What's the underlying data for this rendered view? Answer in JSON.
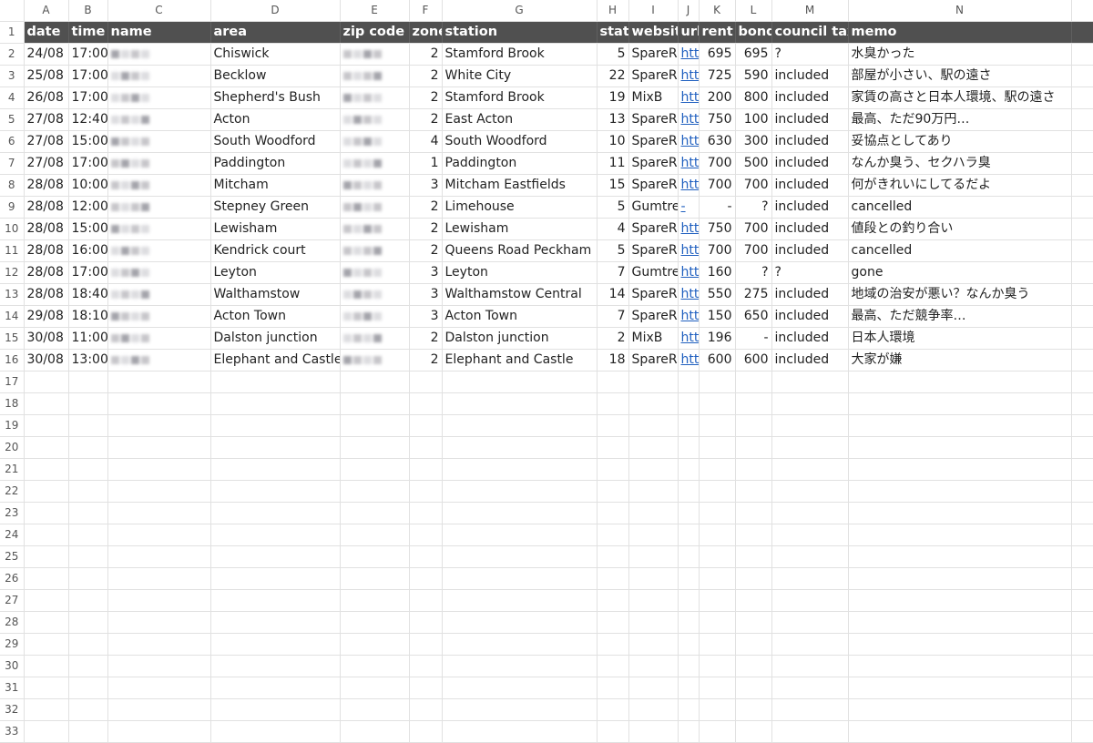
{
  "columns": [
    "A",
    "B",
    "C",
    "D",
    "E",
    "F",
    "G",
    "H",
    "I",
    "J",
    "K",
    "L",
    "M",
    "N"
  ],
  "headers": [
    "date",
    "time",
    "name",
    "area",
    "zip code",
    "zone",
    "station",
    "stati",
    "websit",
    "url",
    "rent",
    "bond",
    "council tax",
    "memo"
  ],
  "rows": [
    {
      "date": "24/08",
      "time": "17:00",
      "area": "Chiswick",
      "zone": "2",
      "station": "Stamford Brook",
      "stati": "5",
      "website": "SpareR",
      "url": "htt",
      "rent": "695",
      "bond": "695",
      "council_tax": "?",
      "memo": "水臭かった"
    },
    {
      "date": "25/08",
      "time": "17:00",
      "area": "Becklow",
      "zone": "2",
      "station": "White City",
      "stati": "22",
      "website": "SpareR",
      "url": "htt",
      "rent": "725",
      "bond": "590",
      "council_tax": "included",
      "memo": "部屋が小さい、駅の遠さ"
    },
    {
      "date": "26/08",
      "time": "17:00",
      "area": "Shepherd's Bush",
      "zone": "2",
      "station": "Stamford Brook",
      "stati": "19",
      "website": "MixB",
      "url": "htt",
      "rent": "200",
      "bond": "800",
      "council_tax": "included",
      "memo": "家賃の高さと日本人環境、駅の遠さ"
    },
    {
      "date": "27/08",
      "time": "12:40",
      "area": "Acton",
      "zone": "2",
      "station": "East Acton",
      "stati": "13",
      "website": "SpareR",
      "url": "htt",
      "rent": "750",
      "bond": "100",
      "council_tax": "included",
      "memo": "最高、ただ90万円…"
    },
    {
      "date": "27/08",
      "time": "15:00",
      "area": "South Woodford",
      "zone": "4",
      "station": "South Woodford",
      "stati": "10",
      "website": "SpareR",
      "url": "htt",
      "rent": "630",
      "bond": "300",
      "council_tax": "included",
      "memo": "妥協点としてあり"
    },
    {
      "date": "27/08",
      "time": "17:00",
      "area": "Paddington",
      "zone": "1",
      "station": "Paddington",
      "stati": "11",
      "website": "SpareR",
      "url": "htt",
      "rent": "700",
      "bond": "500",
      "council_tax": "included",
      "memo": "なんか臭う、セクハラ臭"
    },
    {
      "date": "28/08",
      "time": "10:00",
      "area": "Mitcham",
      "zone": "3",
      "station": "Mitcham Eastfields",
      "stati": "15",
      "website": "SpareR",
      "url": "htt",
      "rent": "700",
      "bond": "700",
      "council_tax": "included",
      "memo": "何がきれいにしてるだよ"
    },
    {
      "date": "28/08",
      "time": "12:00",
      "area": "Stepney Green",
      "zone": "2",
      "station": "Limehouse",
      "stati": "5",
      "website": "Gumtre",
      "url": "-",
      "rent": "-",
      "bond": "?",
      "council_tax": "included",
      "memo": "cancelled"
    },
    {
      "date": "28/08",
      "time": "15:00",
      "area": "Lewisham",
      "zone": "2",
      "station": "Lewisham",
      "stati": "4",
      "website": "SpareR",
      "url": "htt",
      "rent": "750",
      "bond": "700",
      "council_tax": "included",
      "memo": "値段との釣り合い"
    },
    {
      "date": "28/08",
      "time": "16:00",
      "area": "Kendrick court",
      "zone": "2",
      "station": "Queens Road Peckham",
      "stati": "5",
      "website": "SpareR",
      "url": "htt",
      "rent": "700",
      "bond": "700",
      "council_tax": "included",
      "memo": "cancelled"
    },
    {
      "date": "28/08",
      "time": "17:00",
      "area": "Leyton",
      "zone": "3",
      "station": "Leyton",
      "stati": "7",
      "website": "Gumtre",
      "url": "htt",
      "rent": "160",
      "bond": "?",
      "council_tax": "?",
      "memo": "gone"
    },
    {
      "date": "28/08",
      "time": "18:40",
      "area": "Walthamstow",
      "zone": "3",
      "station": "Walthamstow Central",
      "stati": "14",
      "website": "SpareR",
      "url": "htt",
      "rent": "550",
      "bond": "275",
      "council_tax": "included",
      "memo": "地域の治安が悪い？なんか臭う"
    },
    {
      "date": "29/08",
      "time": "18:10",
      "area": "Acton Town",
      "zone": "3",
      "station": "Acton Town",
      "stati": "7",
      "website": "SpareR",
      "url": "htt",
      "rent": "150",
      "bond": "650",
      "council_tax": "included",
      "memo": "最高、ただ競争率…"
    },
    {
      "date": "30/08",
      "time": "11:00",
      "area": "Dalston junction",
      "zone": "2",
      "station": "Dalston junction",
      "stati": "2",
      "website": "MixB",
      "url": "htt",
      "rent": "196",
      "bond": "-",
      "council_tax": "included",
      "memo": "日本人環境"
    },
    {
      "date": "30/08",
      "time": "13:00",
      "area": "Elephant and Castle",
      "zone": "2",
      "station": "Elephant and Castle",
      "stati": "18",
      "website": "SpareR",
      "url": "htt",
      "rent": "600",
      "bond": "600",
      "council_tax": "included",
      "memo": "大家が嫌"
    }
  ],
  "row_numbers": [
    "1",
    "2",
    "3",
    "4",
    "5",
    "6",
    "7",
    "8",
    "9",
    "10",
    "11",
    "12",
    "13",
    "14",
    "15",
    "16",
    "17",
    "18",
    "19",
    "20",
    "21",
    "22",
    "23",
    "24",
    "25",
    "26",
    "27",
    "28",
    "29",
    "30",
    "31",
    "32",
    "33"
  ]
}
